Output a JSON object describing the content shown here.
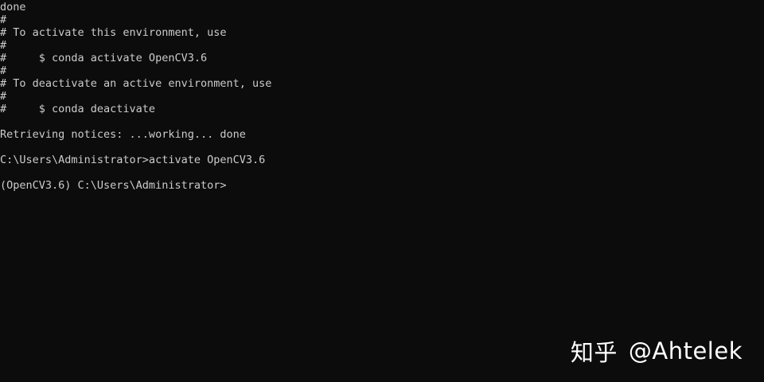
{
  "terminal": {
    "lines": [
      "done",
      "#",
      "# To activate this environment, use",
      "#",
      "#     $ conda activate OpenCV3.6",
      "#",
      "# To deactivate an active environment, use",
      "#",
      "#     $ conda deactivate",
      "",
      "Retrieving notices: ...working... done",
      "",
      "C:\\Users\\Administrator>activate OpenCV3.6",
      "",
      "(OpenCV3.6) C:\\Users\\Administrator>"
    ],
    "background_color": "#0c0c0c",
    "text_color": "#cccccc"
  },
  "watermark": {
    "brand": "知乎",
    "handle": "@Ahtelek"
  }
}
